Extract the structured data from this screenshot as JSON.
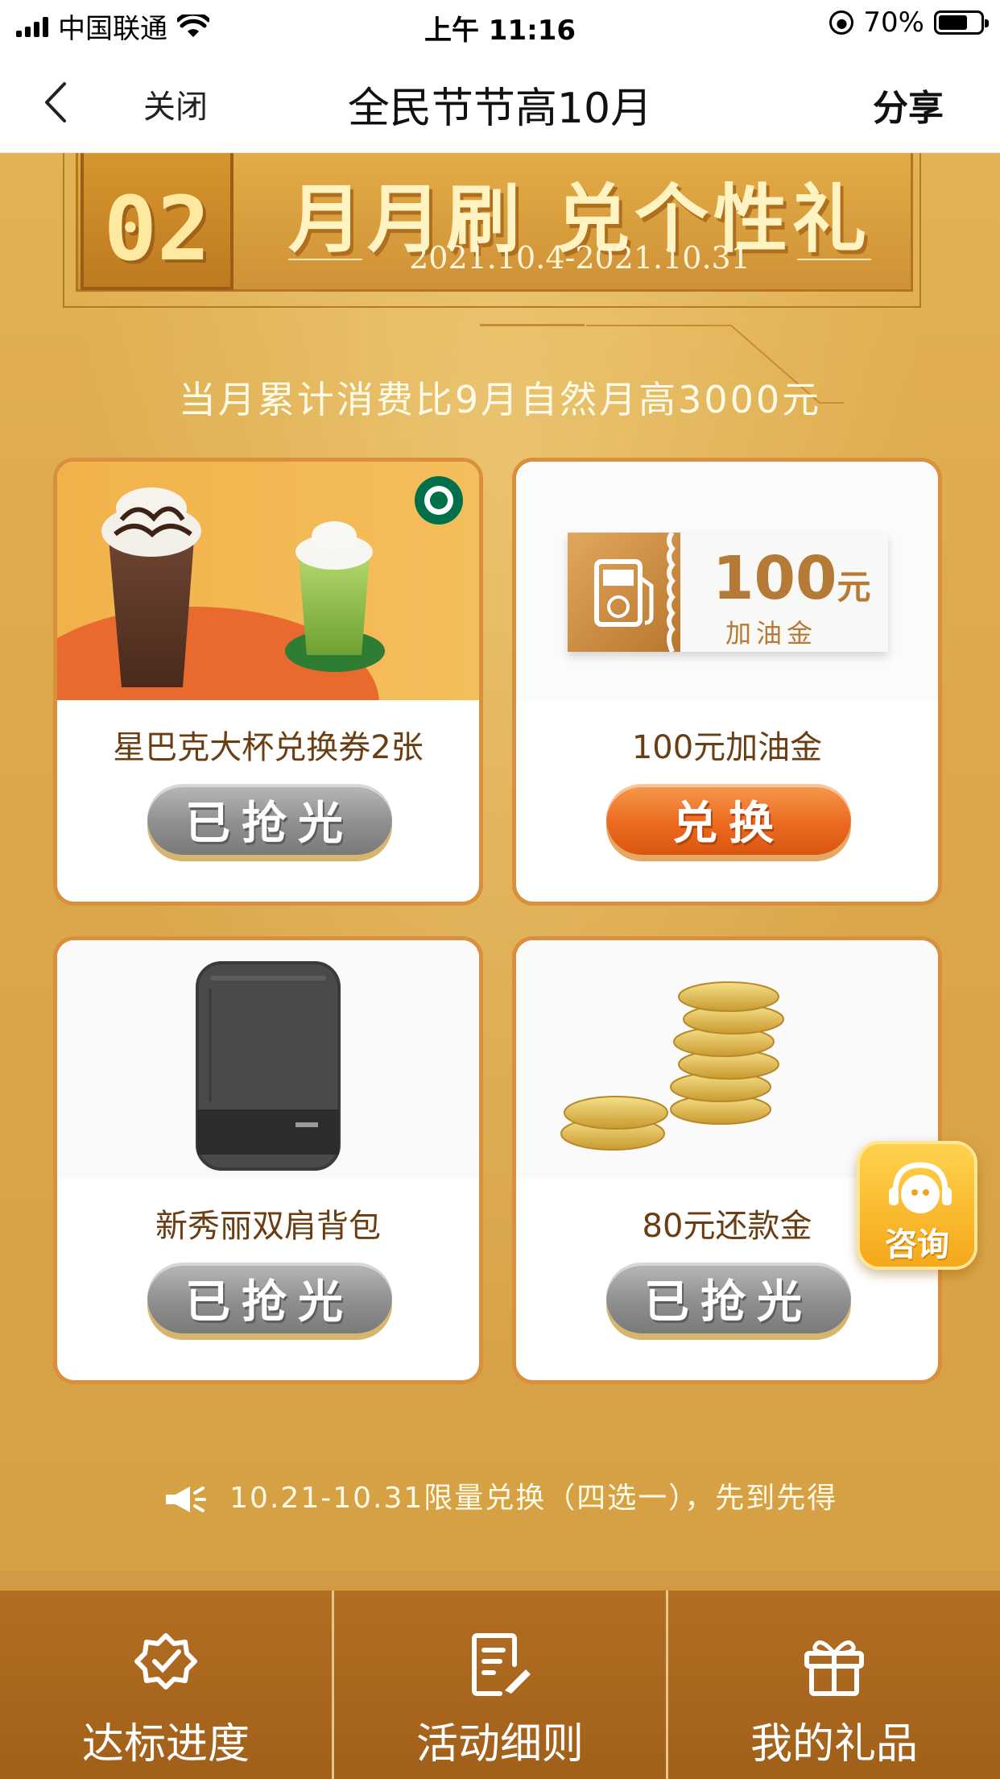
{
  "status_bar": {
    "carrier": "中国联通",
    "time": "上午 11:16",
    "battery": "70%"
  },
  "nav": {
    "close_label": "关闭",
    "title": "全民节节高10月",
    "share_label": "分享"
  },
  "section": {
    "number": "02",
    "title": "月月刷 兑个性礼",
    "date_range": "2021.10.4-2021.10.31",
    "condition": "当月累计消费比9月自然月高3000元"
  },
  "rewards": [
    {
      "label": "星巴克大杯兑换券2张",
      "button": "已抢光",
      "status": "sold-out"
    },
    {
      "label": "100元加油金",
      "button": "兑换",
      "status": "available",
      "coupon": {
        "amount": "100",
        "unit": "元",
        "subtitle": "加油金"
      }
    },
    {
      "label": "新秀丽双肩背包",
      "button": "已抢光",
      "status": "sold-out"
    },
    {
      "label": "80元还款金",
      "button": "已抢光",
      "status": "sold-out"
    }
  ],
  "notice": "10.21-10.31限量兑换（四选一），先到先得",
  "consult_label": "咨询",
  "tabs": [
    {
      "label": "达标进度",
      "icon": "badge-check-icon"
    },
    {
      "label": "活动细则",
      "icon": "document-edit-icon"
    },
    {
      "label": "我的礼品",
      "icon": "gift-icon"
    }
  ],
  "colors": {
    "background": "#d9a446",
    "card_border": "#d98f3c",
    "exchange_button": "#ec6a20",
    "soldout_button": "#8f8f8f",
    "tab_bar": "#a8661d"
  }
}
